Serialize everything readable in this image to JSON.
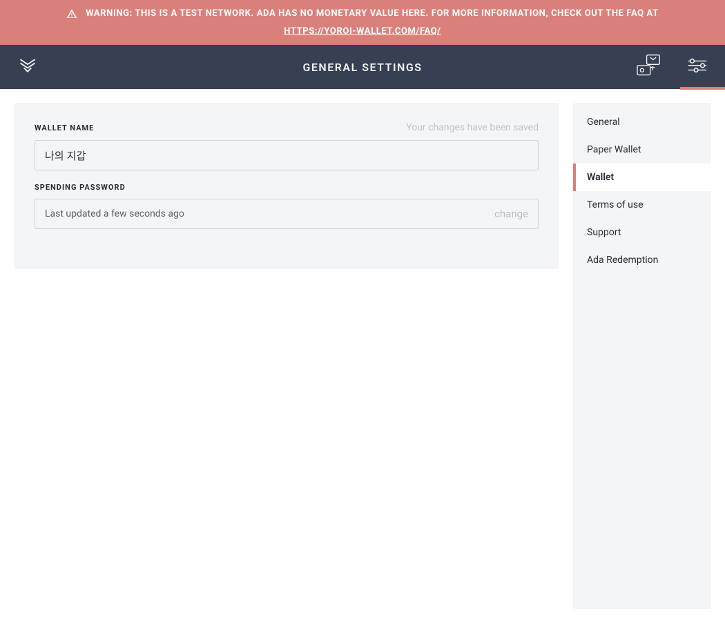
{
  "colors": {
    "accent": "#da807a",
    "header_bg": "#373f52",
    "panel_bg": "#f4f5f7"
  },
  "banner": {
    "text": "WARNING: THIS IS A TEST NETWORK. ADA HAS NO MONETARY VALUE HERE. FOR MORE INFORMATION, CHECK OUT THE FAQ AT",
    "link_text": "HTTPS://YOROI-WALLET.COM/FAQ/"
  },
  "header": {
    "title": "GENERAL SETTINGS",
    "icons": {
      "logo": "yoroi-logo-icon",
      "wallets": "wallet-stack-icon",
      "settings": "sliders-icon"
    }
  },
  "form": {
    "wallet_name_label": "WALLET NAME",
    "wallet_name_value": "나의 지갑",
    "saved_message": "Your changes have been saved",
    "spending_password_label": "SPENDING PASSWORD",
    "last_updated_text": "Last updated a few seconds ago",
    "change_label": "change"
  },
  "sidebar": {
    "items": [
      {
        "label": "General",
        "active": false
      },
      {
        "label": "Paper Wallet",
        "active": false
      },
      {
        "label": "Wallet",
        "active": true
      },
      {
        "label": "Terms of use",
        "active": false
      },
      {
        "label": "Support",
        "active": false
      },
      {
        "label": "Ada Redemption",
        "active": false
      }
    ]
  }
}
